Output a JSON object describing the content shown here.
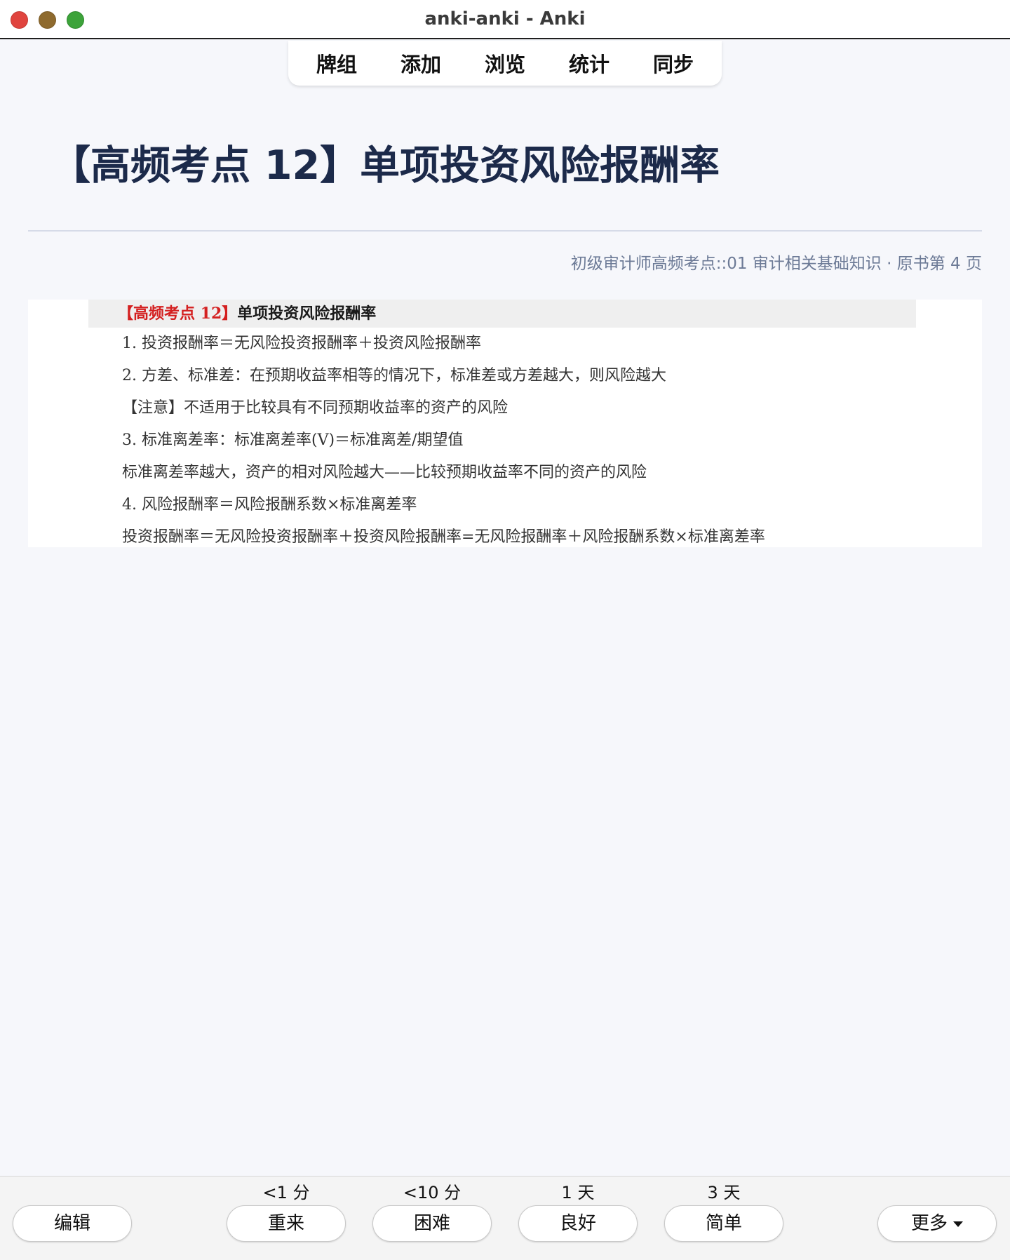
{
  "window": {
    "title": "anki-anki - Anki"
  },
  "nav": {
    "items": [
      "牌组",
      "添加",
      "浏览",
      "统计",
      "同步"
    ]
  },
  "card": {
    "title": "【高频考点 12】单项投资风险报酬率",
    "deck_path": "初级审计师高频考点::01 审计相关基础知识 · 原书第 4 页"
  },
  "page_image": {
    "heading_red": "【高频考点 12】",
    "heading_black": "单项投资风险报酬率",
    "lines": [
      "1. 投资报酬率＝无风险投资报酬率＋投资风险报酬率",
      "2. 方差、标准差：在预期收益率相等的情况下，标准差或方差越大，则风险越大",
      "【注意】不适用于比较具有不同预期收益率的资产的风险",
      "3. 标准离差率：标准离差率(V)＝标准离差/期望值",
      "标准离差率越大，资产的相对风险越大——比较预期收益率不同的资产的风险",
      "4. 风险报酬率＝风险报酬系数×标准离差率",
      "投资报酬率＝无风险投资报酬率＋投资风险报酬率=无风险报酬率＋风险报酬系数×标准离差率"
    ]
  },
  "bottom": {
    "edit_label": "编辑",
    "more_label": "更多",
    "answers": [
      {
        "interval": "<1 分",
        "label": "重来"
      },
      {
        "interval": "<10 分",
        "label": "困难"
      },
      {
        "interval": "1 天",
        "label": "良好"
      },
      {
        "interval": "3 天",
        "label": "简单"
      }
    ]
  }
}
